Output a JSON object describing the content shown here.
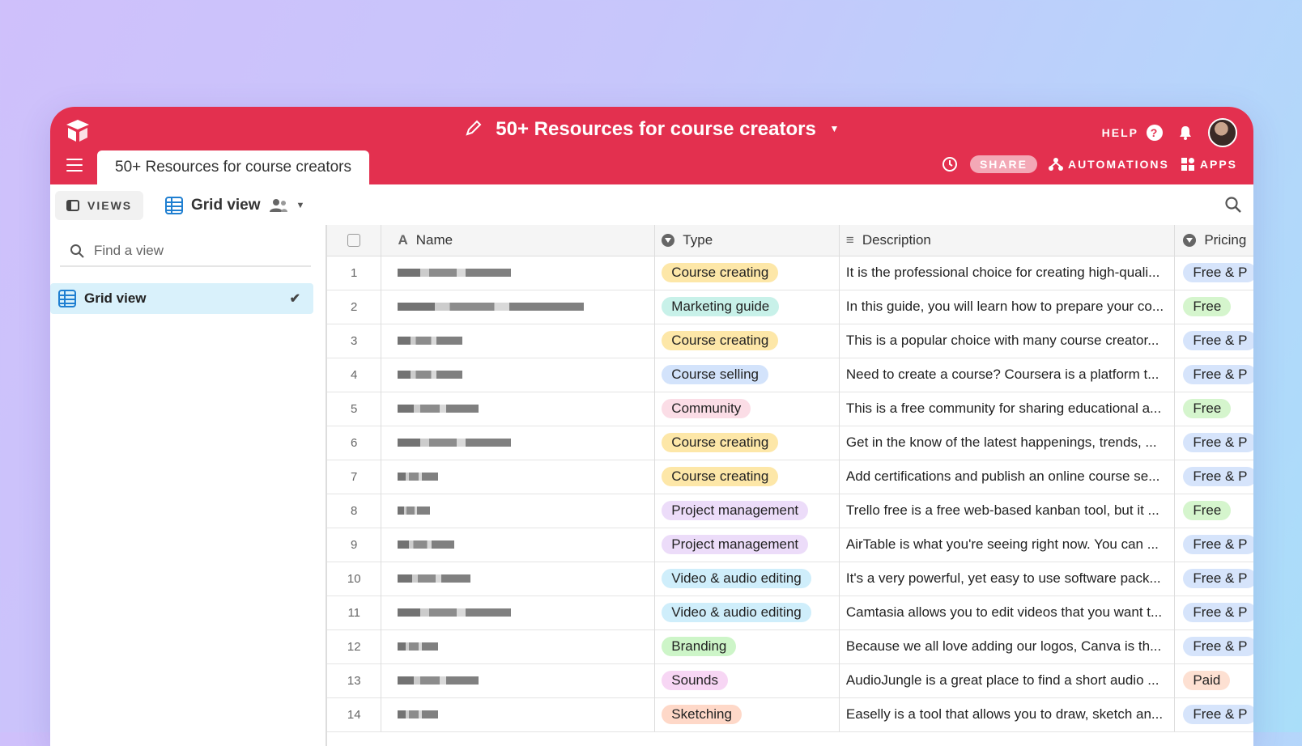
{
  "app": {
    "base_title": "50+ Resources for course creators",
    "help_label": "HELP",
    "help_icon_glyph": "?",
    "tab_label": "50+ Resources for course creators",
    "share_label": "SHARE",
    "automations_label": "AUTOMATIONS",
    "apps_label": "APPS",
    "accent": "#e3304f"
  },
  "viewbar": {
    "views_label": "VIEWS",
    "current_view": "Grid view"
  },
  "sidebar": {
    "search_placeholder": "Find a view",
    "items": [
      {
        "label": "Grid view",
        "selected": true
      }
    ]
  },
  "table": {
    "columns": {
      "name": "Name",
      "type": "Type",
      "description": "Description",
      "pricing": "Pricing"
    },
    "rows": [
      {
        "num": "1",
        "type": "Course creating",
        "type_color": "#fde7a8",
        "description": "It is the professional choice for creating high-quali...",
        "pricing": "Free & P",
        "pricing_color": "#d6e4fb"
      },
      {
        "num": "2",
        "type": "Marketing guide",
        "type_color": "#c8f1e9",
        "description": "In this guide, you will learn how to prepare your co...",
        "pricing": "Free",
        "pricing_color": "#d5f5cd"
      },
      {
        "num": "3",
        "type": "Course creating",
        "type_color": "#fde7a8",
        "description": "This is a popular choice with many course creator...",
        "pricing": "Free & P",
        "pricing_color": "#d6e4fb"
      },
      {
        "num": "4",
        "type": "Course selling",
        "type_color": "#d3e3fb",
        "description": "Need to create a course? Coursera is a platform t...",
        "pricing": "Free & P",
        "pricing_color": "#d6e4fb"
      },
      {
        "num": "5",
        "type": "Community",
        "type_color": "#fbdde6",
        "description": "This is a free community for sharing educational a...",
        "pricing": "Free",
        "pricing_color": "#d5f5cd"
      },
      {
        "num": "6",
        "type": "Course creating",
        "type_color": "#fde7a8",
        "description": "Get in the know of the latest happenings, trends, ...",
        "pricing": "Free & P",
        "pricing_color": "#d6e4fb"
      },
      {
        "num": "7",
        "type": "Course creating",
        "type_color": "#fde7a8",
        "description": "Add certifications and publish an online course se...",
        "pricing": "Free & P",
        "pricing_color": "#d6e4fb"
      },
      {
        "num": "8",
        "type": "Project management",
        "type_color": "#ecdcf9",
        "description": "Trello free is a free web-based kanban tool, but it ...",
        "pricing": "Free",
        "pricing_color": "#d5f5cd"
      },
      {
        "num": "9",
        "type": "Project management",
        "type_color": "#ecdcf9",
        "description": "AirTable is what you're seeing right now. You can ...",
        "pricing": "Free & P",
        "pricing_color": "#d6e4fb"
      },
      {
        "num": "10",
        "type": "Video & audio editing",
        "type_color": "#cfeefb",
        "description": "It's a very powerful, yet easy to use software pack...",
        "pricing": "Free & P",
        "pricing_color": "#d6e4fb"
      },
      {
        "num": "11",
        "type": "Video & audio editing",
        "type_color": "#cfeefb",
        "description": "Camtasia allows you to edit videos that you want t...",
        "pricing": "Free & P",
        "pricing_color": "#d6e4fb"
      },
      {
        "num": "12",
        "type": "Branding",
        "type_color": "#cdf5c8",
        "description": "Because we all love adding our logos, Canva is th...",
        "pricing": "Free & P",
        "pricing_color": "#d6e4fb"
      },
      {
        "num": "13",
        "type": "Sounds",
        "type_color": "#f7d6f4",
        "description": "AudioJungle is a great place to find a short audio ...",
        "pricing": "Paid",
        "pricing_color": "#fde0d2"
      },
      {
        "num": "14",
        "type": "Sketching",
        "type_color": "#fed8c8",
        "description": "Easelly is a tool that allows you to draw, sketch an...",
        "pricing": "Free & P",
        "pricing_color": "#d6e4fb"
      }
    ]
  }
}
